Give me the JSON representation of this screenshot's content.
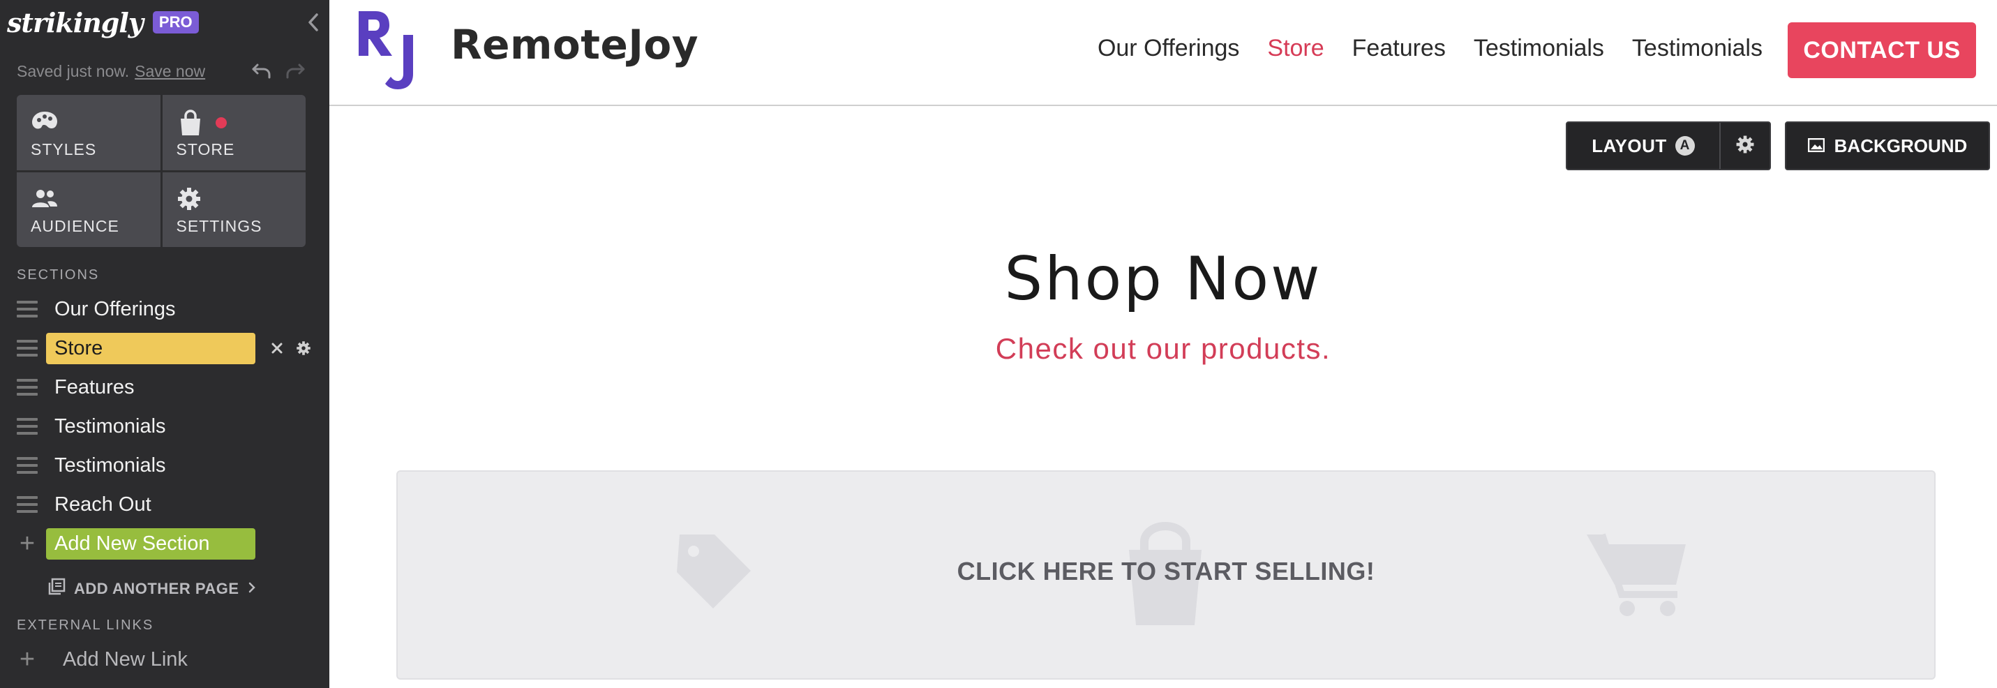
{
  "app": {
    "brand": "strikingly",
    "plan_badge": "PRO",
    "save_status": "Saved just now.",
    "save_link": "Save now"
  },
  "sidebar": {
    "tiles": [
      {
        "label": "STYLES",
        "icon": "palette-icon"
      },
      {
        "label": "STORE",
        "icon": "shopping-bag-icon"
      },
      {
        "label": "AUDIENCE",
        "icon": "people-icon"
      },
      {
        "label": "SETTINGS",
        "icon": "gear-icon"
      }
    ],
    "sections_heading": "SECTIONS",
    "sections": [
      {
        "label": "Our Offerings"
      },
      {
        "label": "Store",
        "active": true
      },
      {
        "label": "Features"
      },
      {
        "label": "Testimonials"
      },
      {
        "label": "Testimonials"
      },
      {
        "label": "Reach Out"
      }
    ],
    "add_section_label": "Add New Section",
    "add_page_label": "ADD ANOTHER PAGE",
    "external_heading": "EXTERNAL LINKS",
    "add_link_label": "Add New Link"
  },
  "header": {
    "site_title": "RemoteJoy",
    "logo_letters": "RJ",
    "nav": [
      {
        "label": "Our Offerings"
      },
      {
        "label": "Store",
        "active": true
      },
      {
        "label": "Features"
      },
      {
        "label": "Testimonials"
      },
      {
        "label": "Testimonials"
      }
    ],
    "contact_label": "CONTACT US"
  },
  "toolbar": {
    "layout_label": "LAYOUT",
    "layout_badge": "A",
    "background_label": "BACKGROUND"
  },
  "main": {
    "title": "Shop Now",
    "subtitle": "Check out our products.",
    "cta": "CLICK HERE TO START SELLING!"
  },
  "colors": {
    "sidebar_bg": "#2c2c2e",
    "tile_bg": "#4a4a4f",
    "active_section": "#efc95a",
    "add_section": "#97bd3e",
    "accent_red": "#e8455e",
    "pro_badge": "#7b5cd6",
    "logo_purple": "#5a3fc0"
  }
}
